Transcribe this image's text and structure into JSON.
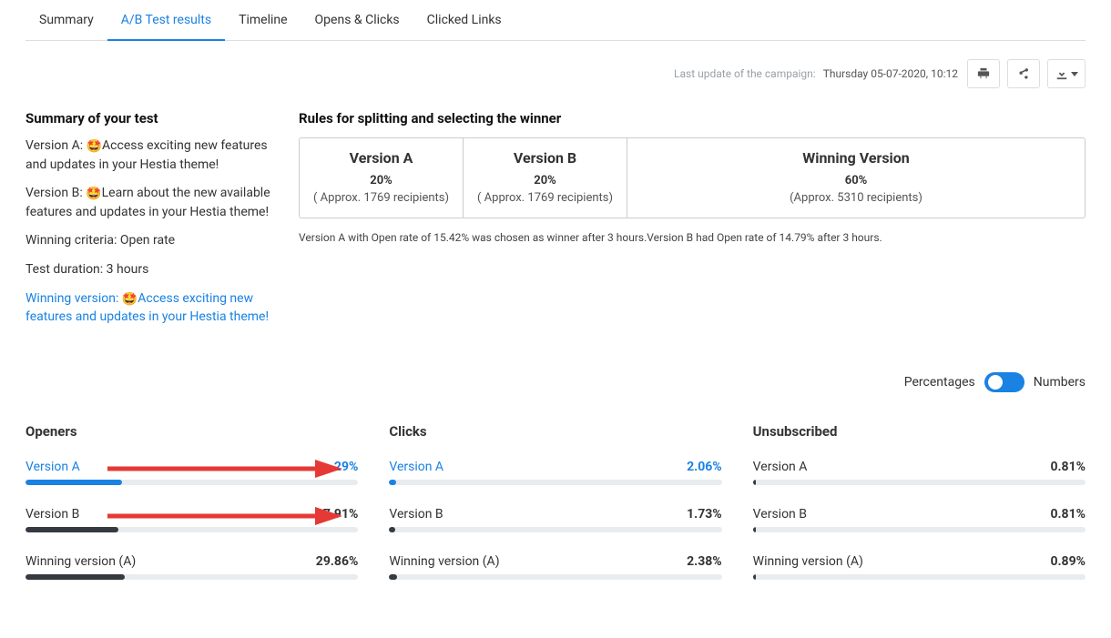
{
  "tabs": {
    "summary": "Summary",
    "ab": "A/B Test results",
    "timeline": "Timeline",
    "opens": "Opens & Clicks",
    "clicked": "Clicked Links"
  },
  "meta": {
    "label": "Last update of the campaign:",
    "date": "Thursday 05-07-2020, 10:12"
  },
  "summary": {
    "title": "Summary of your test",
    "versionA_prefix": "Version A: ",
    "versionA_text": "Access exciting new features and updates in your Hestia theme!",
    "versionB_prefix": "Version B: ",
    "versionB_text": "Learn about the new available features and updates in your Hestia theme!",
    "winning_criteria": "Winning criteria: Open rate",
    "test_duration": "Test duration: 3 hours",
    "winning_prefix": "Winning version: ",
    "winning_text": "Access exciting new features and updates in your Hestia theme!"
  },
  "rules": {
    "title": "Rules for splitting and selecting the winner",
    "a_title": "Version A",
    "a_pct": "20%",
    "a_sub": "( Approx. 1769 recipients)",
    "b_title": "Version B",
    "b_pct": "20%",
    "b_sub": "( Approx. 1769 recipients)",
    "w_title": "Winning Version",
    "w_pct": "60%",
    "w_sub": "(Approx. 5310 recipients)",
    "note": "Version A with Open rate of 15.42% was chosen as winner after 3 hours.Version B had Open rate of 14.79% after 3 hours."
  },
  "toggle": {
    "left": "Percentages",
    "right": "Numbers"
  },
  "metrics": {
    "openers": {
      "title": "Openers",
      "rows": [
        {
          "name": "Version A",
          "val": "29%",
          "pct": 29,
          "color": "blue",
          "highlight": true
        },
        {
          "name": "Version B",
          "val": "27.91%",
          "pct": 27.91,
          "color": "dark",
          "highlight": false
        },
        {
          "name": "Winning version (A)",
          "val": "29.86%",
          "pct": 29.86,
          "color": "dark",
          "highlight": false
        }
      ]
    },
    "clicks": {
      "title": "Clicks",
      "rows": [
        {
          "name": "Version A",
          "val": "2.06%",
          "pct": 2.06,
          "color": "blue",
          "highlight": true
        },
        {
          "name": "Version B",
          "val": "1.73%",
          "pct": 1.73,
          "color": "dark",
          "highlight": false
        },
        {
          "name": "Winning version (A)",
          "val": "2.38%",
          "pct": 2.38,
          "color": "dark",
          "highlight": false
        }
      ]
    },
    "unsub": {
      "title": "Unsubscribed",
      "rows": [
        {
          "name": "Version A",
          "val": "0.81%",
          "pct": 0.81,
          "color": "dark",
          "highlight": false
        },
        {
          "name": "Version B",
          "val": "0.81%",
          "pct": 0.81,
          "color": "dark",
          "highlight": false
        },
        {
          "name": "Winning version (A)",
          "val": "0.89%",
          "pct": 0.89,
          "color": "dark",
          "highlight": false
        }
      ]
    }
  },
  "chart_data": [
    {
      "type": "bar",
      "title": "Openers",
      "categories": [
        "Version A",
        "Version B",
        "Winning version (A)"
      ],
      "values": [
        29,
        27.91,
        29.86
      ],
      "ylim": [
        0,
        100
      ],
      "ylabel": "%"
    },
    {
      "type": "bar",
      "title": "Clicks",
      "categories": [
        "Version A",
        "Version B",
        "Winning version (A)"
      ],
      "values": [
        2.06,
        1.73,
        2.38
      ],
      "ylim": [
        0,
        100
      ],
      "ylabel": "%"
    },
    {
      "type": "bar",
      "title": "Unsubscribed",
      "categories": [
        "Version A",
        "Version B",
        "Winning version (A)"
      ],
      "values": [
        0.81,
        0.81,
        0.89
      ],
      "ylim": [
        0,
        100
      ],
      "ylabel": "%"
    }
  ]
}
